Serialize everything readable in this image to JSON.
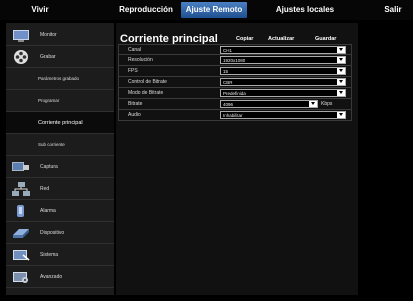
{
  "menu": {
    "items": [
      "Vivir",
      "Reproducción",
      "Ajuste Remoto",
      "Ajustes locales",
      "Salir"
    ],
    "active": "Ajuste Remoto"
  },
  "sidebar": {
    "items": [
      {
        "label": "Monitor",
        "icon": "monitor-icon"
      },
      {
        "label": "Grabar",
        "icon": "film-reel-icon"
      },
      {
        "label": "Parámetros grabado",
        "icon": ""
      },
      {
        "label": "Programar",
        "icon": ""
      },
      {
        "label": "Corriente principal",
        "icon": ""
      },
      {
        "label": "Sub corriente",
        "icon": ""
      },
      {
        "label": "Captura",
        "icon": "camera-icon"
      },
      {
        "label": "Red",
        "icon": "network-icon"
      },
      {
        "label": "Alarma",
        "icon": "alarm-icon"
      },
      {
        "label": "Dispositivo",
        "icon": "disk-icon"
      },
      {
        "label": "Sistema",
        "icon": "system-icon"
      },
      {
        "label": "Avanzado",
        "icon": "advanced-icon"
      }
    ],
    "active": "Corriente principal"
  },
  "panel": {
    "title": "Corriente principal",
    "actions": [
      "Copiar",
      "Actualizar",
      "Guardar"
    ]
  },
  "form": {
    "rows": [
      {
        "label": "Canal",
        "value": "CH1",
        "unit": ""
      },
      {
        "label": "Resolución",
        "value": "1920x1080",
        "unit": ""
      },
      {
        "label": "FPS",
        "value": "15",
        "unit": ""
      },
      {
        "label": "Control de Bitrate",
        "value": "CBR",
        "unit": ""
      },
      {
        "label": "Modo de Bitrate",
        "value": "Predefinida",
        "unit": ""
      },
      {
        "label": "Bitrate",
        "value": "4096",
        "unit": "Kbps"
      },
      {
        "label": "Audio",
        "value": "Inhabilitar",
        "unit": ""
      }
    ]
  },
  "colors": {
    "menu_active": "#2f65a9",
    "sidebar_bg": "#1c1c1c",
    "main_bg": "#111111"
  }
}
